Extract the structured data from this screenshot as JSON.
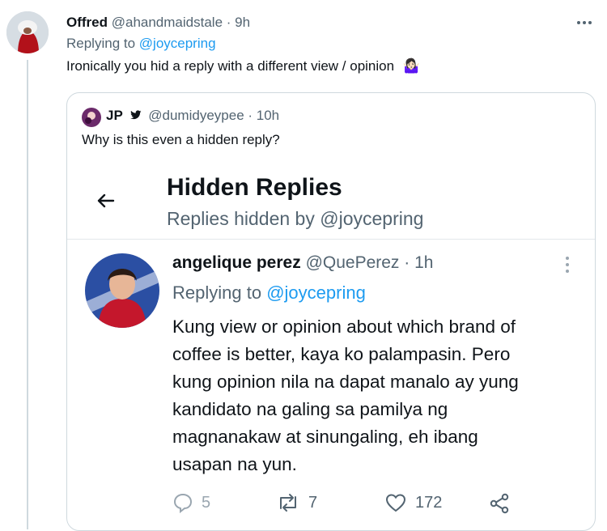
{
  "tweet": {
    "display_name": "Offred",
    "handle_time": "@ahandmaidstale · 9h",
    "replying_prefix": "Replying to ",
    "replying_handle": "@joycepring",
    "text": "Ironically you hid a reply with a different view / opinion",
    "emoji": "🤷🏻‍♀️",
    "more_icon": "more-horizontal-icon"
  },
  "quoted": {
    "display_name": "JP",
    "handle_time": "@dumidyeypee · 10h",
    "text": "Why is this even a hidden reply?",
    "hidden_panel": {
      "title": "Hidden Replies",
      "subtitle": "Replies hidden by @joycepring"
    },
    "reply": {
      "display_name": "angelique perez",
      "handle_time": "@QuePerez · 1h",
      "replying_prefix": "Replying to ",
      "replying_handle": "@joycepring",
      "text_lines": [
        "Kung view or opinion about which brand of",
        "coffee is better, kaya ko palampasin. Pero",
        "kung opinion nila na dapat manalo ay yung",
        "kandidato na galing sa pamilya ng",
        "magnanakaw at sinungaling, eh ibang",
        "usapan na yun."
      ],
      "actions": {
        "replies": "5",
        "retweets": "7",
        "likes": "172"
      }
    }
  },
  "colors": {
    "link": "#1d9bf0",
    "muted": "#536471",
    "border": "#cfd9de"
  }
}
